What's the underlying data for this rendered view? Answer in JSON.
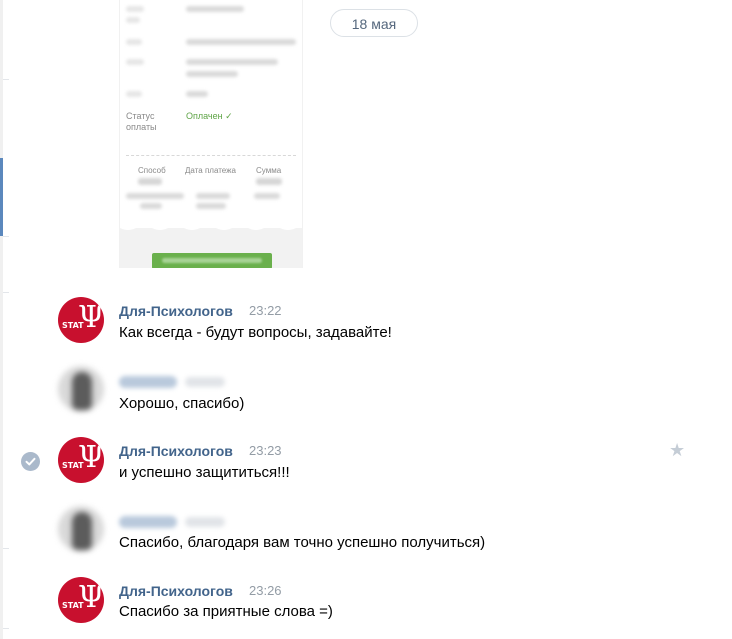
{
  "receipt": {
    "status_label": "Статус оплаты",
    "status_value": "Оплачен ✓",
    "columns": [
      {
        "label": "Способ"
      },
      {
        "label": "Дата платежа"
      },
      {
        "label": "Сумма"
      }
    ]
  },
  "date_separator": "18 мая",
  "messages": [
    {
      "author": "Для-Психологов",
      "time": "23:22",
      "text": "Как всегда - будут вопросы, задавайте!"
    },
    {
      "text": "Хорошо, спасибо)"
    },
    {
      "author": "Для-Психологов",
      "time": "23:23",
      "text": "и успешно защититься!!!"
    },
    {
      "text": "Спасибо, благодаря вам точно успешно получиться)"
    },
    {
      "author": "Для-Психологов",
      "time": "23:26",
      "text": "Спасибо за приятные слова =)"
    }
  ],
  "brand_avatar": {
    "glyph": "Ψ",
    "caption": "STAT"
  },
  "icons": {
    "check": "check-circle-icon",
    "star": "star-icon"
  },
  "colors": {
    "author": "#42648b",
    "brand": "#c8102e",
    "accent": "#5b88bd"
  }
}
